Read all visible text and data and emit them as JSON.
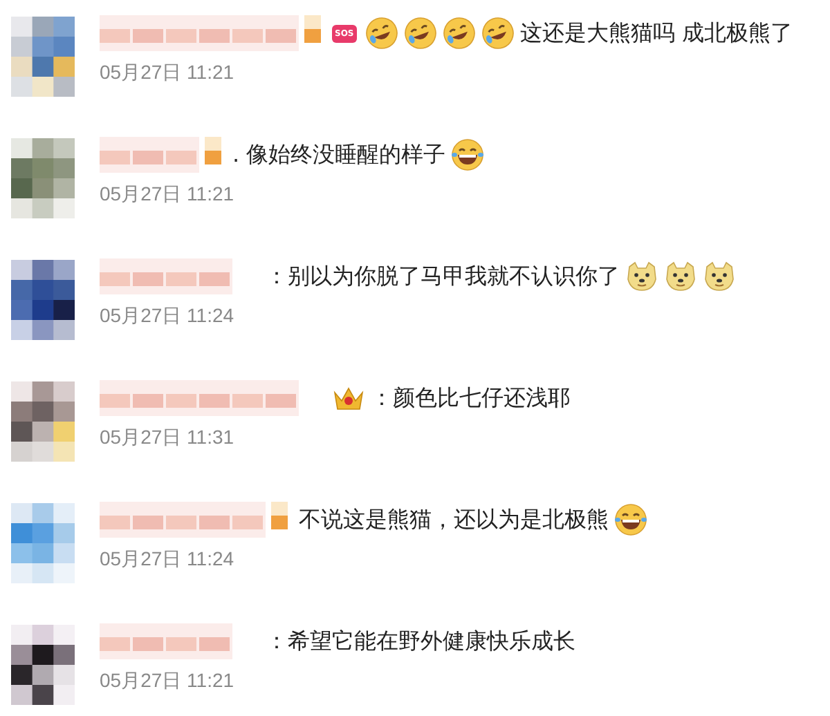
{
  "comments": [
    {
      "avatar": {
        "kind": "picture"
      },
      "badge": "SOS",
      "emoji_before": [
        {
          "kind": "laugh-cry"
        },
        {
          "kind": "laugh-cry"
        },
        {
          "kind": "laugh-cry"
        },
        {
          "kind": "laugh-cry"
        }
      ],
      "text": "这还是大熊猫吗 成北极熊了",
      "time": "05月27日 11:21"
    },
    {
      "avatar": {
        "kind": "picture"
      },
      "text": ".  像始终没睡醒的样子",
      "emoji_after": [
        {
          "kind": "laugh"
        }
      ],
      "time": "05月27日 11:21"
    },
    {
      "avatar": {
        "kind": "picture"
      },
      "text": "：别以为你脱了马甲我就不认识你了",
      "emoji_after": [
        {
          "kind": "doge"
        },
        {
          "kind": "doge"
        },
        {
          "kind": "doge"
        }
      ],
      "time": "05月27日 11:24"
    },
    {
      "avatar": {
        "kind": "picture"
      },
      "emoji_before": [
        {
          "kind": "crown"
        }
      ],
      "text": "：颜色比七仔还浅耶",
      "time": "05月27日 11:31"
    },
    {
      "avatar": {
        "kind": "picture"
      },
      "text": "不说这是熊猫，还以为是北极熊",
      "emoji_after": [
        {
          "kind": "laugh"
        }
      ],
      "time": "05月27日 11:24"
    },
    {
      "avatar": {
        "kind": "picture"
      },
      "text": "：希望它能在野外健康快乐成长",
      "time": "05月27日 11:21"
    }
  ]
}
